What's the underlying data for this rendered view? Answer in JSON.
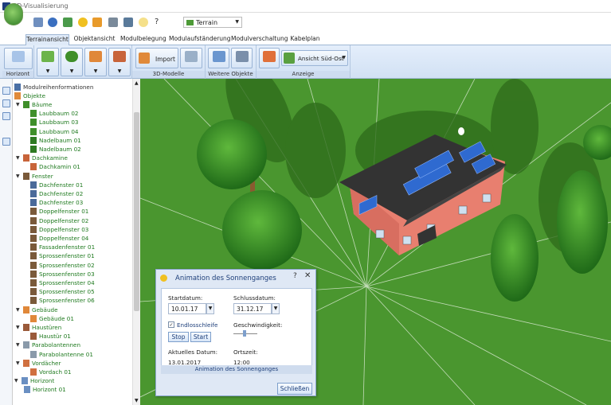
{
  "window": {
    "title": "3D-Visualisierung"
  },
  "toolbar": {
    "terrain_select": "Terrain",
    "icons": [
      "undo-icon",
      "info-icon",
      "refresh-icon",
      "sun-icon",
      "calendar-icon",
      "wrench-icon",
      "camera-icon",
      "lightbulb-icon",
      "help-icon"
    ]
  },
  "tabs": [
    {
      "label": "Terrainansicht",
      "active": true
    },
    {
      "label": "Objektansicht",
      "active": false
    },
    {
      "label": "Modulbelegung",
      "active": false
    },
    {
      "label": "Modulaufständerung",
      "active": false
    },
    {
      "label": "Modulverschaltung",
      "active": false
    },
    {
      "label": "Kabelplan",
      "active": false
    }
  ],
  "ribbon": {
    "horizont_label": "Horizont",
    "import_label": "Import",
    "group_3d": "3D-Modelle",
    "group_weitere": "Weitere Objekte",
    "ansicht_label": "Ansicht Süd-Ost",
    "group_anzeige": "Anzeige"
  },
  "tree": {
    "root": "Modulreihenformationen",
    "objekte": "Objekte",
    "rows": [
      {
        "label": "Bäume",
        "level": 1,
        "icon": "tree-icon"
      },
      {
        "label": "Laubbaum 02",
        "level": 2,
        "icon": "tree-icon"
      },
      {
        "label": "Laubbaum 03",
        "level": 2,
        "icon": "tree-icon"
      },
      {
        "label": "Laubbaum 04",
        "level": 2,
        "icon": "tree-icon"
      },
      {
        "label": "Nadelbaum 01",
        "level": 2,
        "icon": "conifer-icon"
      },
      {
        "label": "Nadelbaum 02",
        "level": 2,
        "icon": "conifer-icon"
      },
      {
        "label": "Dachkamine",
        "level": 1,
        "icon": "chimney-icon"
      },
      {
        "label": "Dachkamin 01",
        "level": 2,
        "icon": "chimney-icon"
      },
      {
        "label": "Fenster",
        "level": 1,
        "icon": "window-icon"
      },
      {
        "label": "Dachfenster 01",
        "level": 2,
        "icon": "roof-window-icon"
      },
      {
        "label": "Dachfenster 02",
        "level": 2,
        "icon": "roof-window-icon"
      },
      {
        "label": "Dachfenster 03",
        "level": 2,
        "icon": "roof-window-icon"
      },
      {
        "label": "Doppelfenster 01",
        "level": 2,
        "icon": "window-icon"
      },
      {
        "label": "Doppelfenster 02",
        "level": 2,
        "icon": "window-icon"
      },
      {
        "label": "Doppelfenster 03",
        "level": 2,
        "icon": "window-icon"
      },
      {
        "label": "Doppelfenster 04",
        "level": 2,
        "icon": "window-icon"
      },
      {
        "label": "Fassadenfenster 01",
        "level": 2,
        "icon": "window-icon"
      },
      {
        "label": "Sprossenfenster 01",
        "level": 2,
        "icon": "window-icon"
      },
      {
        "label": "Sprossenfenster 02",
        "level": 2,
        "icon": "window-icon"
      },
      {
        "label": "Sprossenfenster 03",
        "level": 2,
        "icon": "window-icon"
      },
      {
        "label": "Sprossenfenster 04",
        "level": 2,
        "icon": "window-icon"
      },
      {
        "label": "Sprossenfenster 05",
        "level": 2,
        "icon": "window-icon"
      },
      {
        "label": "Sprossenfenster 06",
        "level": 2,
        "icon": "window-icon"
      },
      {
        "label": "Gebäude",
        "level": 1,
        "icon": "house-icon"
      },
      {
        "label": "Gebäude 01",
        "level": 2,
        "icon": "house-icon"
      },
      {
        "label": "Haustüren",
        "level": 1,
        "icon": "door-icon"
      },
      {
        "label": "Haustür 01",
        "level": 2,
        "icon": "door-icon"
      },
      {
        "label": "Parabolantennen",
        "level": 1,
        "icon": "satellite-dish-icon"
      },
      {
        "label": "Parabolantenne 01",
        "level": 2,
        "icon": "satellite-dish-icon"
      },
      {
        "label": "Vordächer",
        "level": 1,
        "icon": "canopy-icon"
      },
      {
        "label": "Vordach 01",
        "level": 2,
        "icon": "canopy-icon"
      }
    ],
    "horizont": "Horizont",
    "horizont_child": "Horizont 01"
  },
  "dialog": {
    "title": "Animation des Sonnenganges",
    "start_label": "Startdatum:",
    "start_value": "10.01.17",
    "end_label": "Schlussdatum:",
    "end_value": "31.12.17",
    "loop_label": "Endlosschleife",
    "loop_checked": true,
    "speed_label": "Geschwindigkeit:",
    "speed_level": 0.45,
    "stop_label": "Stop",
    "start_btn_label": "Start",
    "current_date_label": "Aktuelles Datum:",
    "current_date_value": "13.01.2017",
    "time_label": "Ortszeit:",
    "time_value": "12:00",
    "footer": "Animation des Sonnenganges",
    "close_label": "Schließen"
  },
  "colors": {
    "accent": "#1e3f7a",
    "tree_text": "#1f7a1f",
    "grass": "#4e9a31"
  }
}
